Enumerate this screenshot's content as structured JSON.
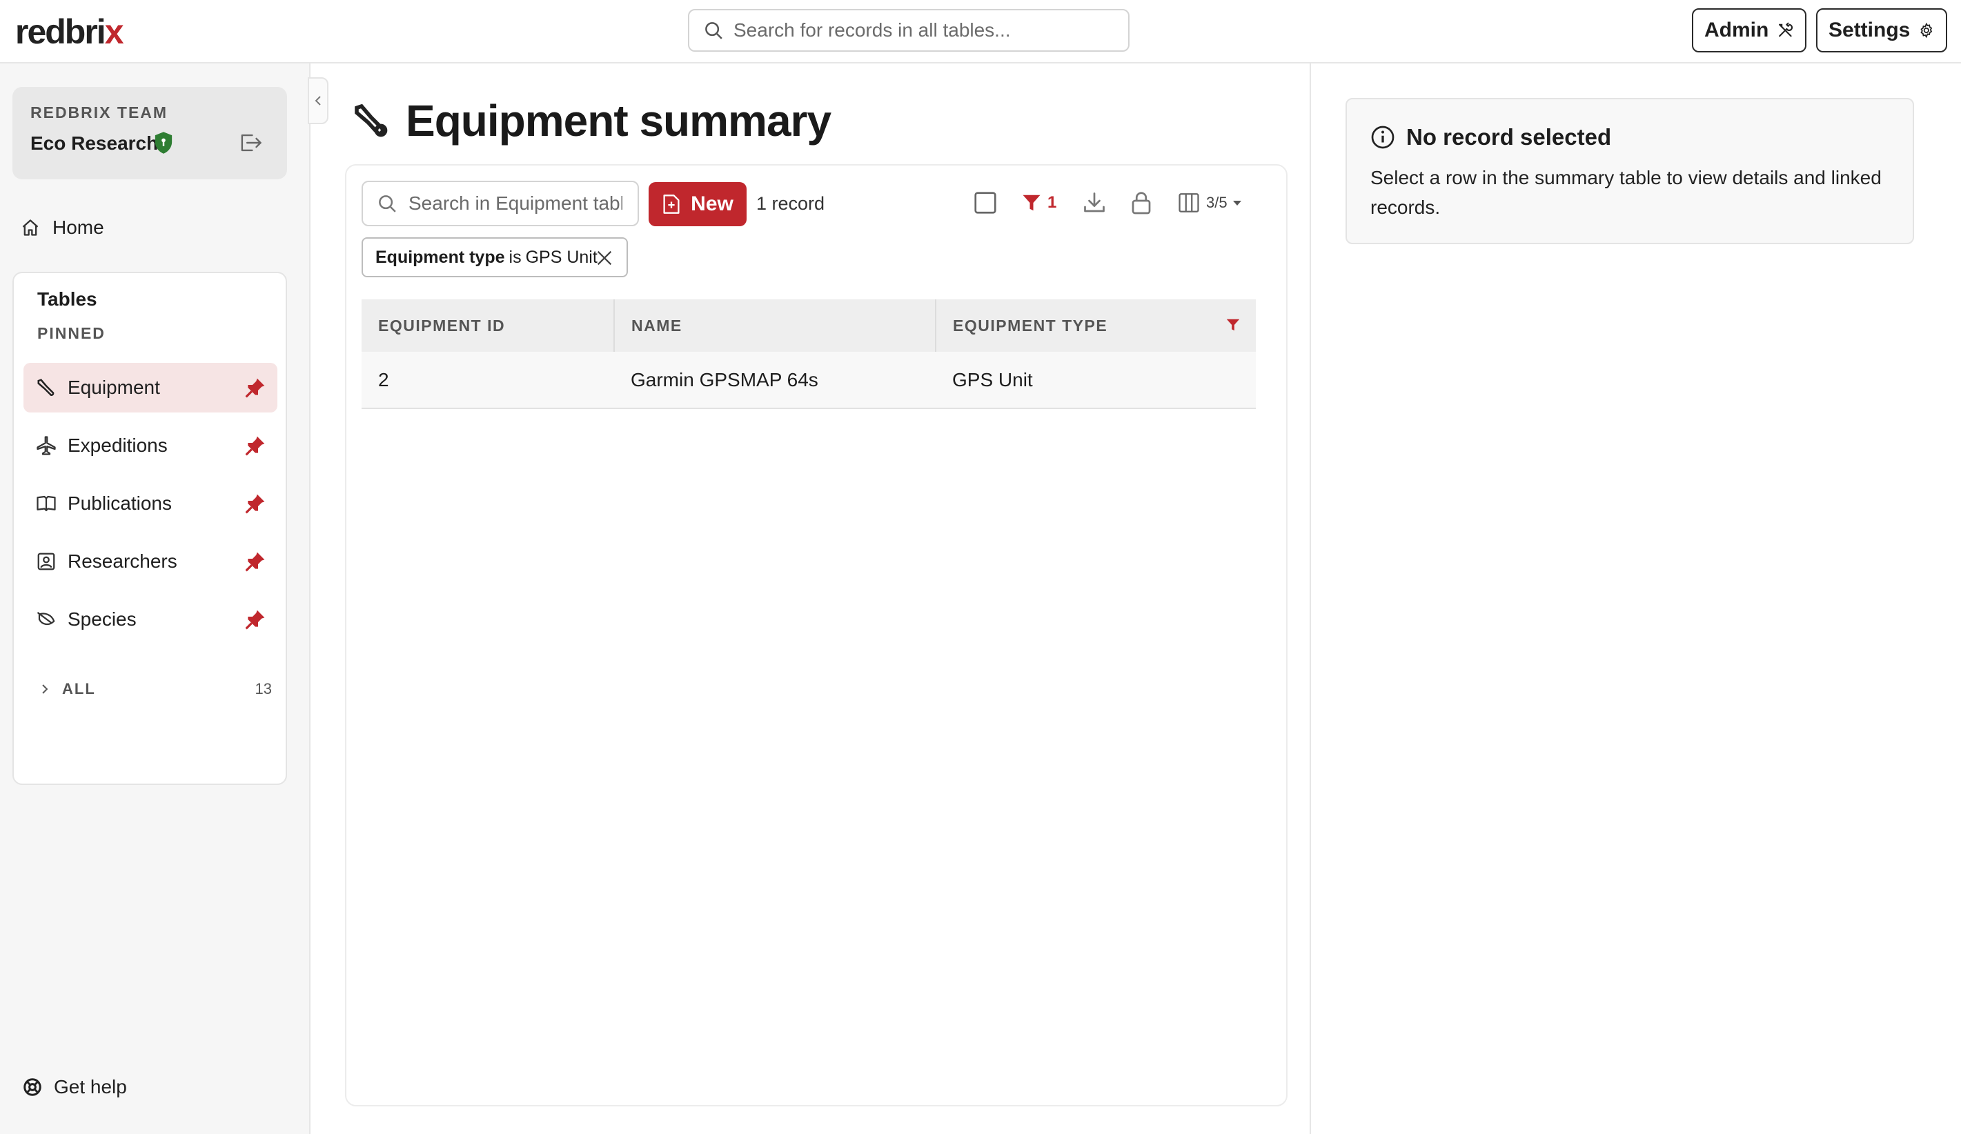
{
  "app": {
    "logo_main": "redbri",
    "logo_accent": "x"
  },
  "topbar": {
    "search_placeholder": "Search for records in all tables...",
    "admin_label": "Admin",
    "settings_label": "Settings"
  },
  "sidebar": {
    "team_label": "REDBRIX TEAM",
    "team_name": "Eco Research",
    "home_label": "Home",
    "tables_title": "Tables",
    "pinned_label": "PINNED",
    "items": [
      {
        "label": "Equipment",
        "icon": "wrench-icon",
        "active": true
      },
      {
        "label": "Expeditions",
        "icon": "airplane-icon",
        "active": false
      },
      {
        "label": "Publications",
        "icon": "book-icon",
        "active": false
      },
      {
        "label": "Researchers",
        "icon": "person-badge-icon",
        "active": false
      },
      {
        "label": "Species",
        "icon": "leaf-icon",
        "active": false
      }
    ],
    "all_label": "ALL",
    "all_count": "13",
    "help_label": "Get help"
  },
  "main": {
    "title": "Equipment summary",
    "search_placeholder": "Search in Equipment table",
    "new_label": "New",
    "record_count": "1 record",
    "filter_count": "1",
    "columns_label": "3/5",
    "filter_chip": {
      "field": "Equipment type",
      "operator": "is",
      "value": "GPS Unit"
    },
    "table": {
      "columns": [
        "EQUIPMENT ID",
        "NAME",
        "EQUIPMENT TYPE"
      ],
      "rows": [
        [
          "2",
          "Garmin GPSMAP 64s",
          "GPS Unit"
        ]
      ]
    }
  },
  "detail": {
    "title": "No record selected",
    "text": "Select a row in the summary table to view details and linked records."
  },
  "colors": {
    "accent": "#c0272d",
    "active_bg": "#f6e4e4",
    "shield": "#2e7d32"
  }
}
